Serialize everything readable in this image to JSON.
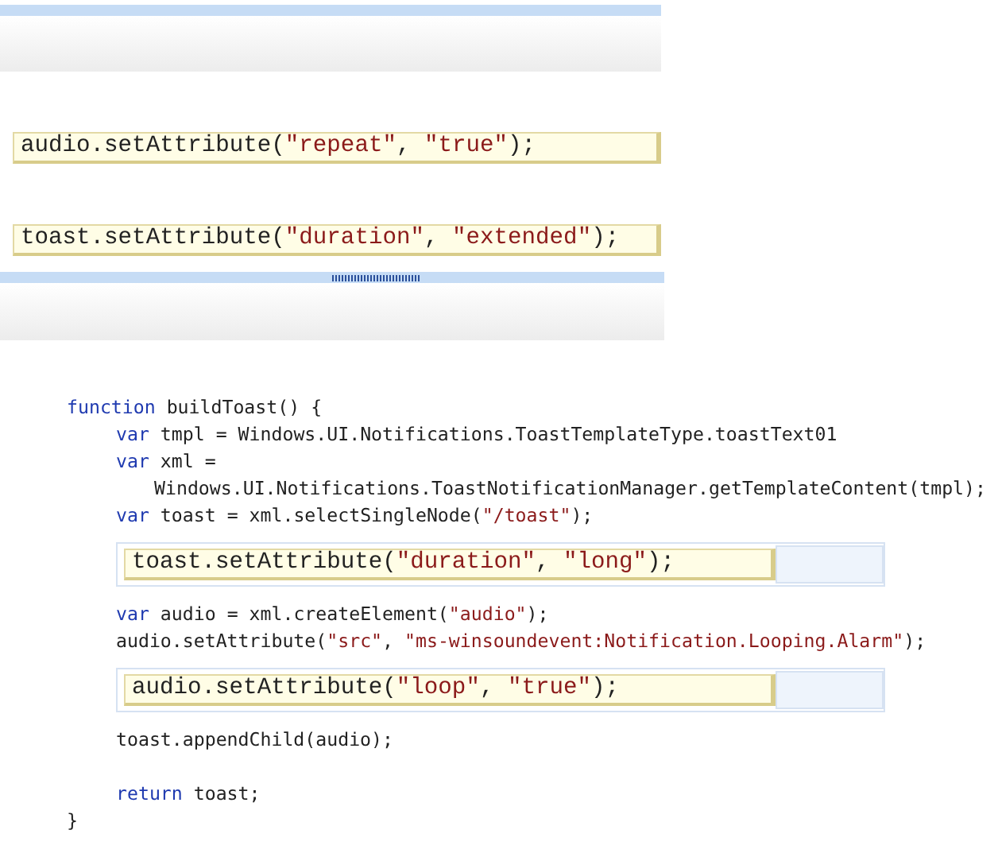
{
  "answer_panel": {
    "options": [
      {
        "tokens": [
          {
            "kind": "plain",
            "text": "audio.setAttribute("
          },
          {
            "kind": "string",
            "text": "\"repeat\""
          },
          {
            "kind": "plain",
            "text": ", "
          },
          {
            "kind": "string",
            "text": "\"true\""
          },
          {
            "kind": "plain",
            "text": ");"
          }
        ]
      },
      {
        "tokens": [
          {
            "kind": "plain",
            "text": "toast.setAttribute("
          },
          {
            "kind": "string",
            "text": "\"duration\""
          },
          {
            "kind": "plain",
            "text": ", "
          },
          {
            "kind": "string",
            "text": "\"extended\""
          },
          {
            "kind": "plain",
            "text": ");"
          }
        ]
      }
    ]
  },
  "code": [
    {
      "kind": "line",
      "tokens": [
        {
          "kind": "keyword",
          "text": "function"
        },
        {
          "kind": "plain",
          "text": " buildToast() {"
        }
      ],
      "children": [
        {
          "kind": "line",
          "tokens": [
            {
              "kind": "keyword",
              "text": "var"
            },
            {
              "kind": "plain",
              "text": " tmpl = Windows.UI.Notifications.ToastTemplateType.toastText01"
            }
          ]
        },
        {
          "kind": "line",
          "tokens": [
            {
              "kind": "keyword",
              "text": "var"
            },
            {
              "kind": "plain",
              "text": " xml ="
            }
          ],
          "children": [
            {
              "kind": "line",
              "tokens": [
                {
                  "kind": "plain",
                  "text": "Windows.UI.Notifications.ToastNotificationManager.getTemplateContent(tmpl);"
                }
              ]
            }
          ]
        },
        {
          "kind": "line",
          "tokens": [
            {
              "kind": "keyword",
              "text": "var"
            },
            {
              "kind": "plain",
              "text": " toast = xml.selectSingleNode("
            },
            {
              "kind": "string",
              "text": "\"/toast\""
            },
            {
              "kind": "plain",
              "text": ");"
            }
          ]
        },
        {
          "kind": "slot",
          "tokens": [
            {
              "kind": "plain",
              "text": "toast.setAttribute("
            },
            {
              "kind": "string",
              "text": "\"duration\""
            },
            {
              "kind": "plain",
              "text": ", "
            },
            {
              "kind": "string",
              "text": "\"long\""
            },
            {
              "kind": "plain",
              "text": ");"
            }
          ]
        },
        {
          "kind": "line",
          "tokens": [
            {
              "kind": "keyword",
              "text": "var"
            },
            {
              "kind": "plain",
              "text": " audio = xml.createElement("
            },
            {
              "kind": "string",
              "text": "\"audio\""
            },
            {
              "kind": "plain",
              "text": ");"
            }
          ]
        },
        {
          "kind": "line",
          "tokens": [
            {
              "kind": "plain",
              "text": "audio.setAttribute("
            },
            {
              "kind": "string",
              "text": "\"src\""
            },
            {
              "kind": "plain",
              "text": ", "
            },
            {
              "kind": "string",
              "text": "\"ms-winsoundevent:Notification.Looping.Alarm\""
            },
            {
              "kind": "plain",
              "text": ");"
            }
          ]
        },
        {
          "kind": "slot",
          "tokens": [
            {
              "kind": "plain",
              "text": "audio.setAttribute("
            },
            {
              "kind": "string",
              "text": "\"loop\""
            },
            {
              "kind": "plain",
              "text": ", "
            },
            {
              "kind": "string",
              "text": "\"true\""
            },
            {
              "kind": "plain",
              "text": ");"
            }
          ]
        },
        {
          "kind": "line",
          "tokens": [
            {
              "kind": "plain",
              "text": "toast.appendChild(audio);"
            }
          ]
        },
        {
          "kind": "blank"
        },
        {
          "kind": "line",
          "tokens": [
            {
              "kind": "keyword",
              "text": "return"
            },
            {
              "kind": "plain",
              "text": " toast;"
            }
          ]
        }
      ]
    },
    {
      "kind": "line",
      "tokens": [
        {
          "kind": "plain",
          "text": "}"
        }
      ]
    }
  ]
}
